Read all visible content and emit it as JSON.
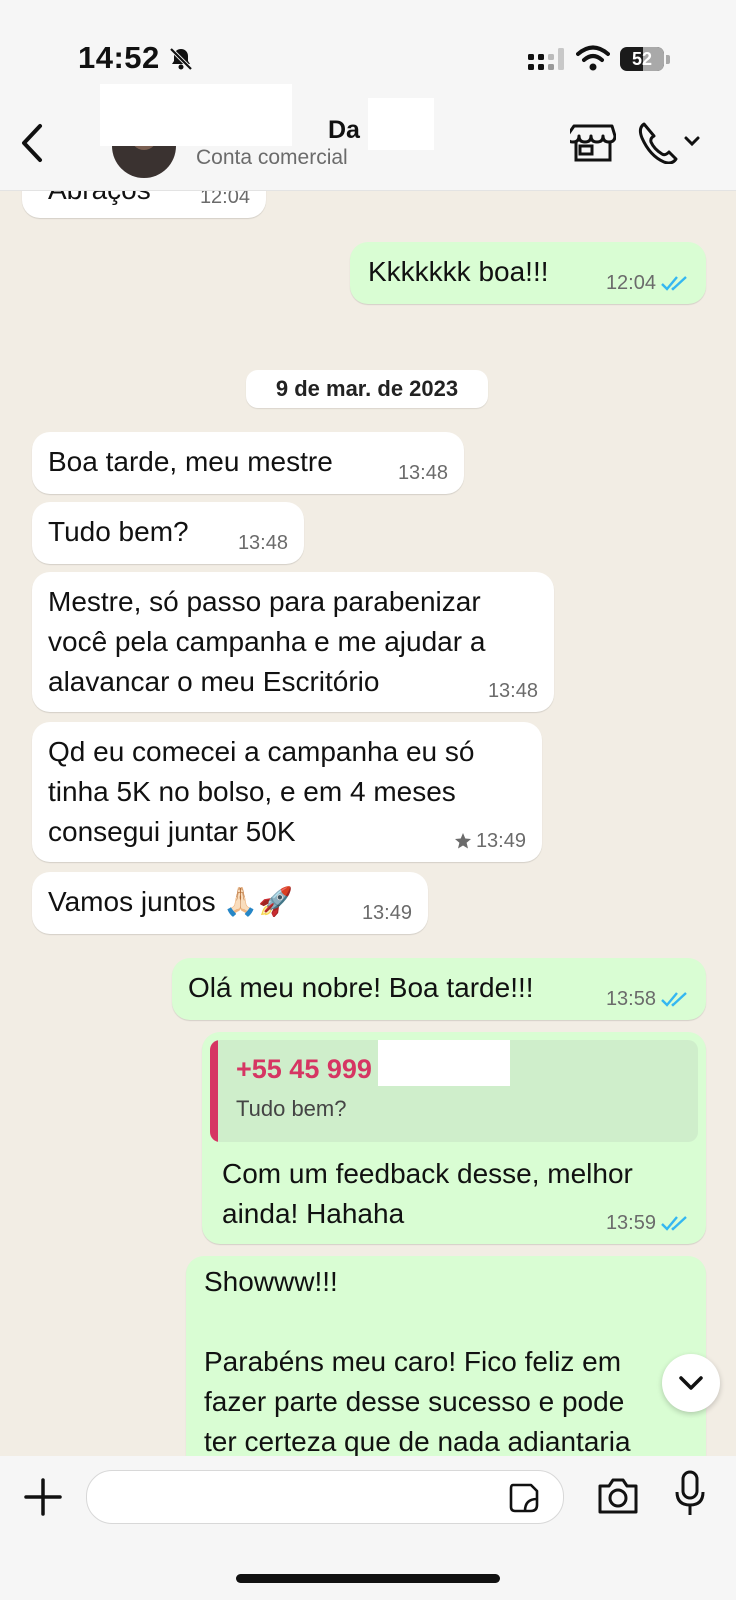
{
  "status_bar": {
    "time": "14:52",
    "battery": "52"
  },
  "header": {
    "contact_name": "Da",
    "contact_subtitle": "Conta comercial"
  },
  "messages": [
    {
      "text": "Abraços",
      "time": "12:04"
    },
    {
      "text": "Kkkkkkk boa!!!",
      "time": "12:04"
    },
    {
      "text": "Boa tarde, meu mestre",
      "time": "13:48"
    },
    {
      "text": "Tudo bem?",
      "time": "13:48"
    },
    {
      "text": "Mestre, só passo para parabenizar\nvocê pela campanha e me ajudar a\nalavancar o meu Escritório",
      "time": "13:48"
    },
    {
      "text": "Qd eu comecei a campanha eu só\ntinha 5K no bolso, e em 4 meses\nconsegui juntar 50K",
      "time": "13:49"
    },
    {
      "text": "Vamos juntos 🙏🏻🚀",
      "time": "13:49"
    },
    {
      "text": "Olá meu nobre! Boa tarde!!!",
      "time": "13:58"
    },
    {
      "text": "Com um feedback desse, melhor\nainda! Hahaha",
      "time": "13:59"
    },
    {
      "text": "Showww!!!\n\nParabéns meu caro! Fico feliz em\nfazer parte desse sucesso e pode\nter certeza que de nada adiantaria",
      "time": ""
    }
  ],
  "date_divider": "9 de mar. de 2023",
  "reply_quote": {
    "author": "+55 45 999",
    "text": "Tudo bem?"
  },
  "composer": {
    "placeholder": ""
  },
  "colors": {
    "incoming": "#ffffff",
    "outgoing": "#d9fdd3",
    "ticks": "#34b7f1",
    "quote_accent": "#d63563"
  },
  "icons": [
    "back-icon",
    "store-icon",
    "phone-icon",
    "chevron-down-icon",
    "plus-icon",
    "sticker-icon",
    "camera-icon",
    "mic-icon",
    "star-icon",
    "double-check-icon",
    "bell-off-icon",
    "wifi-icon",
    "signal-icon"
  ]
}
